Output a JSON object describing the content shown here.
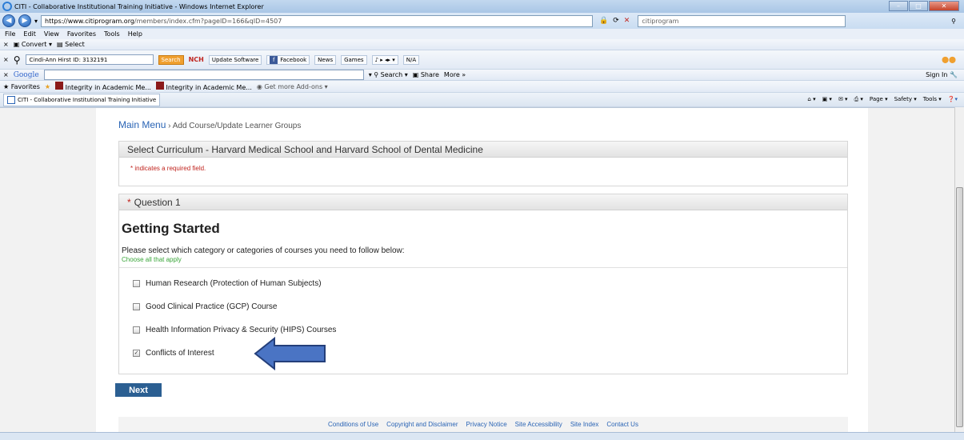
{
  "window": {
    "title": "CITI - Collaborative Institutional Training Initiative - Windows Internet Explorer"
  },
  "address_bar": {
    "url_host": "https://www.citiprogram.org",
    "url_path": "/members/index.cfm?pageID=166&qID=4507",
    "search_value": "citiprogram"
  },
  "menu": [
    "File",
    "Edit",
    "View",
    "Favorites",
    "Tools",
    "Help"
  ],
  "toolbar1": {
    "convert": "Convert",
    "select": "Select"
  },
  "toolbar2": {
    "user_select": "Cindi-Ann Hirst ID: 3132191",
    "search_button": "Search",
    "update_software": "Update Software",
    "facebook": "Facebook",
    "news": "News",
    "games": "Games",
    "na": "N/A"
  },
  "toolbar3": {
    "brand": "Google",
    "search": "Search",
    "share": "Share",
    "more": "More »",
    "sign_in": "Sign In"
  },
  "favorites_bar": {
    "favorites": "Favorites",
    "items": [
      "Integrity in Academic Me...",
      "Integrity in Academic Me...",
      "Get more Add-ons"
    ]
  },
  "tab_bar": {
    "active_tab": "CITI - Collaborative Institutional Training Initiative",
    "tools": [
      "Page",
      "Safety",
      "Tools"
    ]
  },
  "page": {
    "breadcrumb_link": "Main Menu",
    "breadcrumb_rest": " › Add Course/Update Learner Groups",
    "select_header": "Select Curriculum - Harvard Medical School and Harvard School of Dental Medicine",
    "required_note": "* indicates a required field.",
    "question_star": "*",
    "question_label": "Question 1",
    "heading": "Getting Started",
    "prompt": "Please select which category or categories of courses you need to follow below:",
    "hint": "Choose all that apply",
    "options": [
      {
        "label": "Human Research (Protection of Human Subjects)",
        "checked": false
      },
      {
        "label": "Good Clinical Practice (GCP) Course",
        "checked": false
      },
      {
        "label": "Health Information Privacy & Security (HIPS) Courses",
        "checked": false
      },
      {
        "label": "Conflicts of Interest",
        "checked": true
      }
    ],
    "next_button": "Next",
    "footer_links": [
      "Conditions of Use",
      "Copyright and Disclaimer",
      "Privacy Notice",
      "Site Accessibility",
      "Site Index",
      "Contact Us"
    ]
  },
  "colors": {
    "arrow_fill": "#4a74c4",
    "arrow_stroke": "#243f7a",
    "next_bg": "#2b5f92",
    "link": "#2a64b5"
  }
}
